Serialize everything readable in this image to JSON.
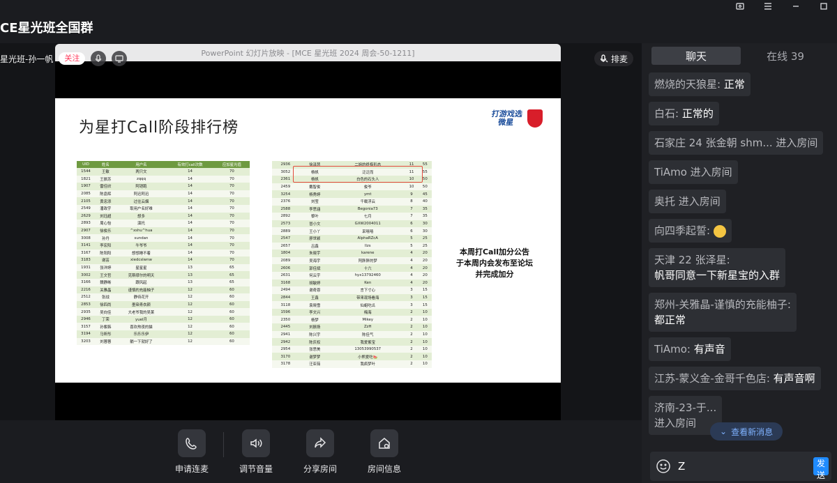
{
  "window": {
    "title": "CE星光班全国群"
  },
  "anchor": {
    "name": "星光班-孙一帆",
    "follow_label": "关注"
  },
  "queue_label": "排麦",
  "ppt": {
    "title": "PowerPoint 幻灯片放映 - [MCE 星光班 2024 周会-50-1211]",
    "slide_title": "为星打Call阶段排行榜",
    "logo_text": "打游戏选微星",
    "notice_lines": [
      "本周打Call加分公告",
      "于本周内会发布至论坛",
      "并完成加分"
    ],
    "table1": {
      "headers": [
        "UID",
        "姓名",
        "用户名",
        "有效打call次数",
        "应加星光值"
      ],
      "rows": [
        [
          "1544",
          "王敏",
          "两只文",
          "14",
          "70"
        ],
        [
          "1821",
          "王振苏",
          "zqqq",
          "14",
          "70"
        ],
        [
          "1907",
          "雷佳欣",
          "阿铠跑",
          "14",
          "70"
        ],
        [
          "2085",
          "陈嘉辉",
          "阿迅阿迅",
          "14",
          "70"
        ],
        [
          "2105",
          "黄忠添",
          "过往云烟",
          "14",
          "70"
        ],
        [
          "2549",
          "潘政宇",
          "取用户名好难",
          "14",
          "70"
        ],
        [
          "2629",
          "刘珏超",
          "想多",
          "14",
          "70"
        ],
        [
          "2893",
          "周心怡",
          "演托",
          "14",
          "70"
        ],
        [
          "2907",
          "徐俊乐",
          "^xshu^hua",
          "14",
          "70"
        ],
        [
          "3008",
          "孙丹",
          "sundan",
          "14",
          "70"
        ],
        [
          "3141",
          "李宏阳",
          "牛爷爷",
          "14",
          "70"
        ],
        [
          "3167",
          "陈阳阳",
          "想想睡不着",
          "14",
          "70"
        ],
        [
          "3183",
          "谢芸",
          "xiedcslwnw",
          "14",
          "70"
        ],
        [
          "1931",
          "张洋婷",
          "星星星",
          "13",
          "65"
        ],
        [
          "3002",
          "王文哲",
          "克斯缪尔的明天",
          "13",
          "65"
        ],
        [
          "3166",
          "魏静晰",
          "跟风起",
          "13",
          "65"
        ],
        [
          "2216",
          "关雅晶",
          "谨慎的充能柚子",
          "12",
          "60"
        ],
        [
          "2512",
          "张战",
          "静待花开",
          "12",
          "60"
        ],
        [
          "2853",
          "徐四尚",
          "墨染青衣颜",
          "12",
          "60"
        ],
        [
          "2935",
          "吴向佳",
          "大老爷我的吴莱",
          "12",
          "60"
        ],
        [
          "2946",
          "丁荣",
          "yuel月",
          "12",
          "60"
        ],
        [
          "3157",
          "孙紫韩",
          "喜欢熬夜的猫",
          "12",
          "60"
        ],
        [
          "3194",
          "马昕彤",
          "乐乐乐伊",
          "12",
          "60"
        ],
        [
          "3203",
          "刘蓉蓉",
          "躺一下就好了",
          "12",
          "60"
        ]
      ]
    },
    "table2": {
      "rows": [
        [
          "2936",
          "徐泽慧",
          "二姐的终极形态",
          "11",
          "55"
        ],
        [
          "3052",
          "杨帆",
          "泛泛而",
          "11",
          "55"
        ],
        [
          "2361",
          "杨帆",
          "白色的石头人",
          "10",
          "50"
        ],
        [
          "2459",
          "戴智俊",
          "俊爷",
          "10",
          "50"
        ],
        [
          "3254",
          "杨秀婷",
          "ymt",
          "9",
          "45"
        ],
        [
          "2376",
          "刘莹",
          "千载浮云",
          "8",
          "40"
        ],
        [
          "2588",
          "李思涵",
          "Begonia73",
          "7",
          "35"
        ],
        [
          "2892",
          "黎叶",
          "七月",
          "7",
          "35"
        ],
        [
          "2573",
          "冒小文",
          "GXW2004011",
          "6",
          "30"
        ],
        [
          "2889",
          "王小丫",
          "呆嘻嘻",
          "6",
          "30"
        ],
        [
          "2547",
          "廖世颖",
          "AlphaRZcA",
          "5",
          "25"
        ],
        [
          "2657",
          "吕鑫",
          "llzs",
          "5",
          "25"
        ],
        [
          "1804",
          "朱晓宇",
          "karene",
          "4",
          "20"
        ],
        [
          "2089",
          "吴海宇",
          "阿胖胖的梦",
          "4",
          "20"
        ],
        [
          "2606",
          "郭佳斌",
          "十六",
          "4",
          "20"
        ],
        [
          "2631",
          "何云宇",
          "hyx13792460",
          "4",
          "20"
        ],
        [
          "3168",
          "胡敏婷",
          "Ken",
          "4",
          "20"
        ],
        [
          "2494",
          "谢奇恩",
          "言下寸心",
          "3",
          "15"
        ],
        [
          "2844",
          "王鑫",
          "带来现场看海",
          "3",
          "15"
        ],
        [
          "3118",
          "袁晓雪",
          "仙蛆吃瓜",
          "3",
          "15"
        ],
        [
          "1596",
          "李文兴",
          "梅海",
          "2",
          "10"
        ],
        [
          "2350",
          "杨梦",
          "Mikey",
          "2",
          "10"
        ],
        [
          "2445",
          "刘振扬",
          "ZzH",
          "2",
          "10"
        ],
        [
          "2941",
          "陈兴宇",
          "陈佳气",
          "2",
          "10"
        ],
        [
          "2942",
          "陈庆权",
          "我爱紫宝",
          "2",
          "10"
        ],
        [
          "2954",
          "张思美",
          "13053990537",
          "2",
          "10"
        ],
        [
          "3170",
          "谢梦梦",
          "小熊爱吃🍉",
          "2",
          "10"
        ],
        [
          "3178",
          "汪亚茹",
          "我疯梦叶",
          "2",
          "10"
        ]
      ]
    }
  },
  "controls": [
    {
      "label": "申请连麦",
      "icon": "phone-icon"
    },
    {
      "label": "调节音量",
      "icon": "speaker-icon"
    },
    {
      "label": "分享房间",
      "icon": "share-icon"
    },
    {
      "label": "房间信息",
      "icon": "house-info-icon"
    }
  ],
  "panel": {
    "tab_chat": "聊天",
    "tab_online": "在线 39",
    "messages": [
      {
        "user": "燃烧的天狼星: ",
        "text": "正常"
      },
      {
        "user": "白石: ",
        "text": "正常的"
      },
      {
        "user": "石家庄 24 张金朝 shm... 进入房间",
        "text": ""
      },
      {
        "user": "TiAmo 进入房间",
        "text": ""
      },
      {
        "user": "奥托 进入房间",
        "text": ""
      },
      {
        "user": "向四季起誓: ",
        "text": ""
      },
      {
        "user": "天津 22 张泽星:",
        "text": "帆哥同意一下新星宝的入群"
      },
      {
        "user": "郑州-关雅晶-谨慎的充能柚子:",
        "text": "都正常"
      },
      {
        "user": "TiAmo: ",
        "text": "有声音"
      },
      {
        "user": "江苏-蒙义金-金哥千色店: ",
        "text": "有声音啊"
      },
      {
        "user": "济南-23-于...",
        "text": "进入房间"
      }
    ],
    "new_msg_label": "查看新消息",
    "input_value": "Z",
    "send_label": "发送"
  }
}
